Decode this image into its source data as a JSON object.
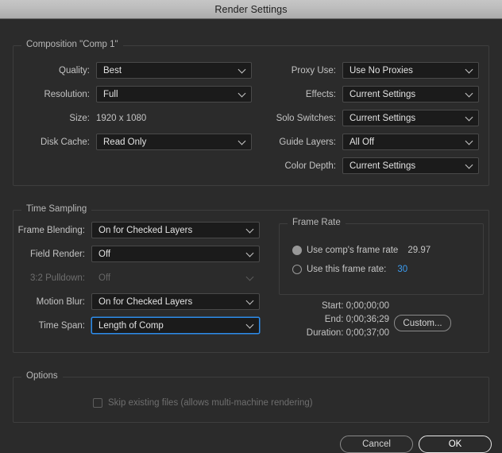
{
  "window": {
    "title": "Render Settings"
  },
  "composition": {
    "group_title": "Composition \"Comp 1\"",
    "left_fields": [
      {
        "label": "Quality:",
        "value": "Best",
        "type": "dropdown"
      },
      {
        "label": "Resolution:",
        "value": "Full",
        "type": "dropdown"
      },
      {
        "label": "Size:",
        "value": "1920 x 1080",
        "type": "static"
      },
      {
        "label": "Disk Cache:",
        "value": "Read Only",
        "type": "dropdown"
      }
    ],
    "right_fields": [
      {
        "label": "Proxy Use:",
        "value": "Use No Proxies",
        "type": "dropdown"
      },
      {
        "label": "Effects:",
        "value": "Current Settings",
        "type": "dropdown"
      },
      {
        "label": "Solo Switches:",
        "value": "Current Settings",
        "type": "dropdown"
      },
      {
        "label": "Guide Layers:",
        "value": "All Off",
        "type": "dropdown"
      },
      {
        "label": "Color Depth:",
        "value": "Current Settings",
        "type": "dropdown"
      }
    ]
  },
  "time_sampling": {
    "group_title": "Time Sampling",
    "fields": [
      {
        "label": "Frame Blending:",
        "value": "On for Checked Layers",
        "disabled": false,
        "focused": false
      },
      {
        "label": "Field Render:",
        "value": "Off",
        "disabled": false,
        "focused": false
      },
      {
        "label": "3:2 Pulldown:",
        "value": "Off",
        "disabled": true,
        "focused": false
      },
      {
        "label": "Motion Blur:",
        "value": "On for Checked Layers",
        "disabled": false,
        "focused": false
      },
      {
        "label": "Time Span:",
        "value": "Length of Comp",
        "disabled": false,
        "focused": true
      }
    ]
  },
  "frame_rate": {
    "group_title": "Frame Rate",
    "options": [
      {
        "label": "Use comp's frame rate",
        "value": "29.97",
        "selected": true,
        "value_is_link": false
      },
      {
        "label": "Use this frame rate:",
        "value": "30",
        "selected": false,
        "value_is_link": true
      }
    ]
  },
  "time_info": {
    "start_label": "Start:",
    "start_value": "0;00;00;00",
    "end_label": "End:",
    "end_value": "0;00;36;29",
    "duration_label": "Duration:",
    "duration_value": "0;00;37;00",
    "custom_button": "Custom..."
  },
  "options": {
    "group_title": "Options",
    "skip_existing_label": "Skip existing files (allows multi-machine rendering)",
    "skip_existing_checked": false
  },
  "footer": {
    "cancel_label": "Cancel",
    "ok_label": "OK"
  },
  "colors": {
    "accent_blue": "#2d8ceb",
    "link_blue": "#3b9cf0",
    "background": "#2b2b2b",
    "field_background": "#1b1b1b",
    "titlebar": "#bcbcbc"
  }
}
